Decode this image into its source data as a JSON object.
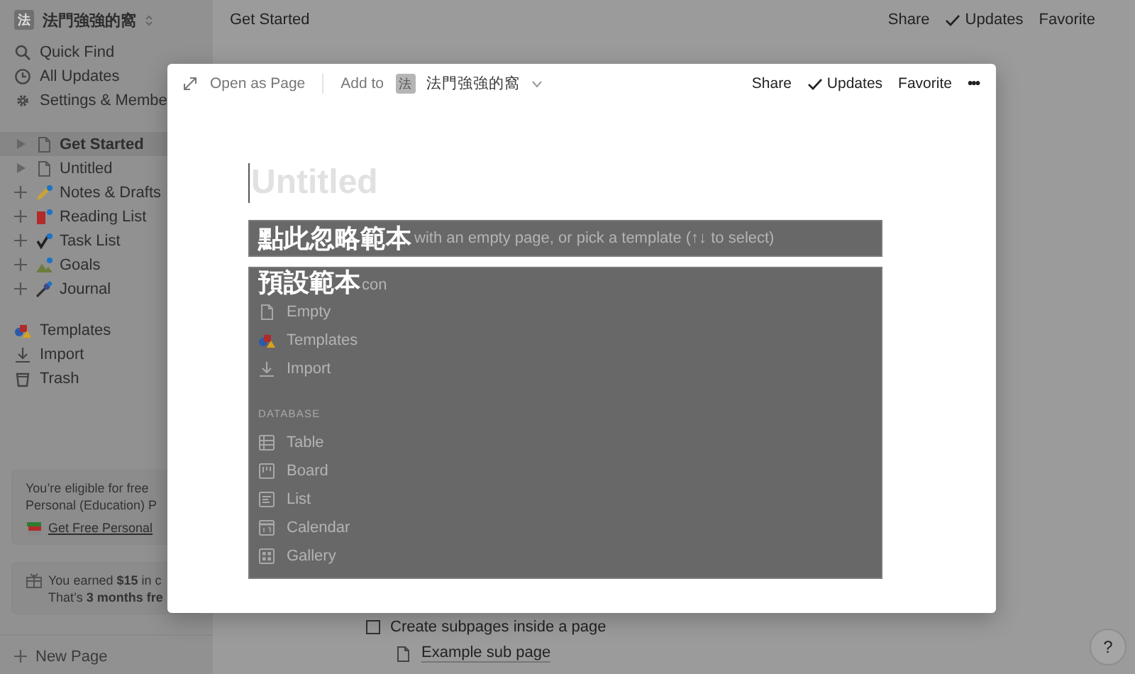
{
  "sidebar": {
    "workspace": {
      "initial": "法",
      "name": "法門強強的窩"
    },
    "nav": [
      {
        "kind": "search",
        "label": "Quick Find"
      },
      {
        "kind": "clock",
        "label": "All Updates"
      },
      {
        "kind": "gear",
        "label": "Settings & Membe"
      }
    ],
    "pages": [
      {
        "kind": "doc",
        "label": "Get Started",
        "selected": true,
        "expandable": true
      },
      {
        "kind": "doc",
        "label": "Untitled",
        "selected": false,
        "expandable": true
      },
      {
        "kind": "pen",
        "label": "Notes & Drafts",
        "selected": false,
        "expandable": false
      },
      {
        "kind": "book",
        "label": "Reading List",
        "selected": false,
        "expandable": false
      },
      {
        "kind": "check",
        "label": "Task List",
        "selected": false,
        "expandable": false
      },
      {
        "kind": "mountain",
        "label": "Goals",
        "selected": false,
        "expandable": false
      },
      {
        "kind": "mic",
        "label": "Journal",
        "selected": false,
        "expandable": false
      }
    ],
    "tools": [
      {
        "kind": "templates",
        "label": "Templates"
      },
      {
        "kind": "import",
        "label": "Import"
      },
      {
        "kind": "trash",
        "label": "Trash"
      }
    ],
    "promo": {
      "lines": [
        "You’re eligible for free",
        "Personal (Education) P"
      ],
      "link": "Get Free Personal"
    },
    "credit": {
      "lines": [
        "You earned **$15** in c",
        "That’s **3 months fre**"
      ]
    },
    "new_page": "New Page"
  },
  "topbar": {
    "title": "Get Started",
    "actions": [
      {
        "kind": "text",
        "label": "Share"
      },
      {
        "kind": "check",
        "label": "Updates"
      },
      {
        "kind": "text",
        "label": "Favorite"
      }
    ]
  },
  "page": {
    "todo": {
      "label": "Create subpages inside a page",
      "checked": false
    },
    "subpage": "Example sub page"
  },
  "help": "?",
  "modal": {
    "open_as_page": "Open as Page",
    "add_to": "Add to",
    "workspace": {
      "initial": "法",
      "name": "法門強強的窩"
    },
    "actions": [
      {
        "kind": "text",
        "label": "Share"
      },
      {
        "kind": "check",
        "label": "Updates"
      },
      {
        "kind": "text",
        "label": "Favorite"
      },
      {
        "kind": "more",
        "label": "•••"
      }
    ],
    "title_placeholder": "Untitled",
    "annotations": [
      {
        "label": "點此忽略範本",
        "hint": "with an empty page, or pick a template (↑↓ to select)"
      },
      {
        "label": "預設範本",
        "hint": "con",
        "items": [
          {
            "kind": "doc",
            "label": "Empty"
          },
          {
            "kind": "templates",
            "label": "Templates"
          },
          {
            "kind": "import",
            "label": "Import"
          },
          {
            "kind": "heading",
            "label": "DATABASE"
          },
          {
            "kind": "table",
            "label": "Table"
          },
          {
            "kind": "board",
            "label": "Board"
          },
          {
            "kind": "list",
            "label": "List"
          },
          {
            "kind": "calendar",
            "label": "Calendar"
          },
          {
            "kind": "gallery",
            "label": "Gallery"
          }
        ]
      }
    ]
  }
}
